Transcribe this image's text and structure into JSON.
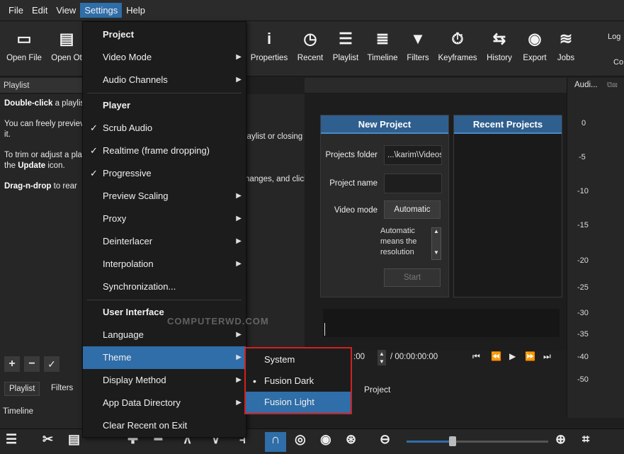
{
  "menubar": [
    "File",
    "Edit",
    "View",
    "Settings",
    "Help"
  ],
  "toolbar": {
    "left": [
      "Open File",
      "Open Ot"
    ],
    "right": [
      {
        "label": "Properties",
        "icon": "info-icon",
        "glyph": "i"
      },
      {
        "label": "Recent",
        "icon": "clock-icon",
        "glyph": "◷"
      },
      {
        "label": "Playlist",
        "icon": "list-icon",
        "glyph": "☰"
      },
      {
        "label": "Timeline",
        "icon": "timeline-icon",
        "glyph": "≣"
      },
      {
        "label": "Filters",
        "icon": "funnel-icon",
        "glyph": "▼"
      },
      {
        "label": "Keyframes",
        "icon": "stopwatch-icon",
        "glyph": "⏱"
      },
      {
        "label": "History",
        "icon": "history-icon",
        "glyph": "⇆"
      },
      {
        "label": "Export",
        "icon": "disc-icon",
        "glyph": "◉"
      },
      {
        "label": "Jobs",
        "icon": "database-icon",
        "glyph": "≋"
      }
    ],
    "edge_top": "Log",
    "edge_bottom": "Co"
  },
  "playlist": {
    "title": "Playlist",
    "p1_bold": "Double-click",
    "p1_rest": " a playlis",
    "p2": "You can freely previev",
    "p2b": "it.",
    "p3": "To trim or adjust a pla",
    "p3b_pre": "the ",
    "p3b_bold": "Update",
    "p3b_post": " icon.",
    "p4_bold": "Drag-n-drop",
    "p4_rest": " to rear",
    "frag1": "laylist or closing",
    "frag2": "hanges, and click"
  },
  "audio": {
    "title": "Audi...",
    "levels": [
      "0",
      "-5",
      "-10",
      "-15",
      "-20",
      "-25",
      "-30",
      "-35",
      "-40",
      "-50"
    ]
  },
  "new_project": {
    "title": "New Project",
    "folder_label": "Projects folder",
    "folder_value": "...\\karim\\Videos",
    "name_label": "Project name",
    "name_value": "",
    "mode_label": "Video mode",
    "mode_value": "Automatic",
    "note": "Automatic means the resolution",
    "start": "Start"
  },
  "recent_projects": {
    "title": "Recent Projects"
  },
  "settings_menu": {
    "project_header": "Project",
    "video_mode": "Video Mode",
    "audio_channels": "Audio Channels",
    "player_header": "Player",
    "scrub_audio": "Scrub Audio",
    "realtime": "Realtime (frame dropping)",
    "progressive": "Progressive",
    "preview_scaling": "Preview Scaling",
    "proxy": "Proxy",
    "deinterlacer": "Deinterlacer",
    "interpolation": "Interpolation",
    "synchronization": "Synchronization...",
    "ui_header": "User Interface",
    "language": "Language",
    "theme": "Theme",
    "display_method": "Display Method",
    "app_data_directory": "App Data Directory",
    "clear_recent": "Clear Recent on Exit"
  },
  "theme_menu": {
    "system": "System",
    "fusion_dark": "Fusion Dark",
    "fusion_light": "Fusion Light"
  },
  "tabs": {
    "playlist": "Playlist",
    "filters": "Filters",
    "project": "Project"
  },
  "timeline": {
    "title": "Timeline"
  },
  "transport": {
    "time_left": ":00",
    "time_total": "/ 00:00:00:00"
  },
  "watermark": "COMPUTERWD.COM",
  "colors": {
    "highlight": "#2f6ea8",
    "annotation": "#d32020"
  }
}
